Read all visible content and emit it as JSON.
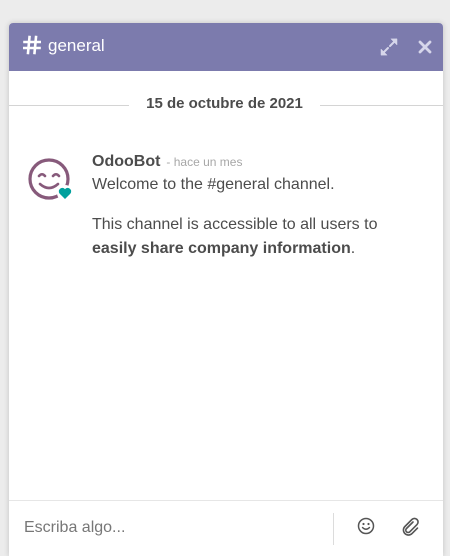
{
  "header": {
    "title": "general",
    "icons": {
      "channel": "hash-icon",
      "expand": "expand-icon",
      "close": "close-icon"
    },
    "background": "#7c7bad"
  },
  "thread": {
    "date_separator": "15 de octubre de 2021",
    "messages": [
      {
        "author": "OdooBot",
        "time": "- hace un mes",
        "avatar_icon": "odoobot-avatar",
        "status_icon": "online-heart-icon",
        "paragraph1": "Welcome to the #general channel.",
        "paragraph2_plain": "This channel is accessible to all users to",
        "paragraph2_bold": "easily share company information",
        "paragraph2_end": "."
      }
    ]
  },
  "composer": {
    "placeholder": "Escriba algo...",
    "value": "",
    "icons": {
      "emoji": "emoji-icon",
      "attach": "paperclip-icon"
    }
  },
  "colors": {
    "accent": "#7c7bad",
    "avatar": "#875a7b",
    "online": "#00a09d",
    "text": "#4c4c4c",
    "muted": "#a7a7a7"
  }
}
